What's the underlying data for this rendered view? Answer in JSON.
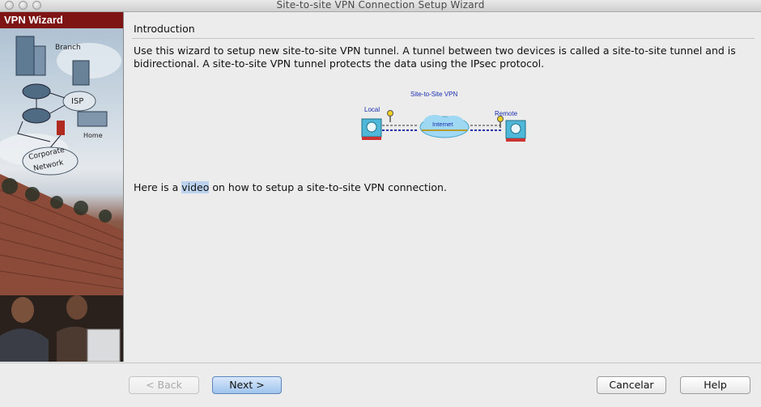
{
  "window": {
    "title": "Site-to-site VPN Connection Setup Wizard"
  },
  "sidebar": {
    "header": "VPN Wizard",
    "art_labels": {
      "branch": "Branch",
      "isp": "ISP",
      "home": "Home",
      "corporate_1": "Corporate",
      "corporate_2": "Network"
    }
  },
  "main": {
    "section_title": "Introduction",
    "intro_text": "Use this wizard to setup new site-to-site VPN tunnel. A tunnel between two devices is called a site-to-site tunnel and is bidirectional. A site-to-site VPN tunnel protects the data using the IPsec protocol.",
    "diagram": {
      "title": "Site-to-Site VPN",
      "local": "Local",
      "remote": "Remote",
      "internet": "Internet"
    },
    "video_line": {
      "before": "Here is a ",
      "link": "video",
      "after": " on how to setup a site-to-site VPN connection."
    }
  },
  "buttons": {
    "back": "< Back",
    "next": "Next >",
    "cancel": "Cancelar",
    "help": "Help"
  },
  "colors": {
    "sidebar_header": "#7e1414",
    "next_button": "#9fc3ec",
    "link_highlight": "#bcd3ef",
    "diagram_text": "#1a2fb0"
  }
}
